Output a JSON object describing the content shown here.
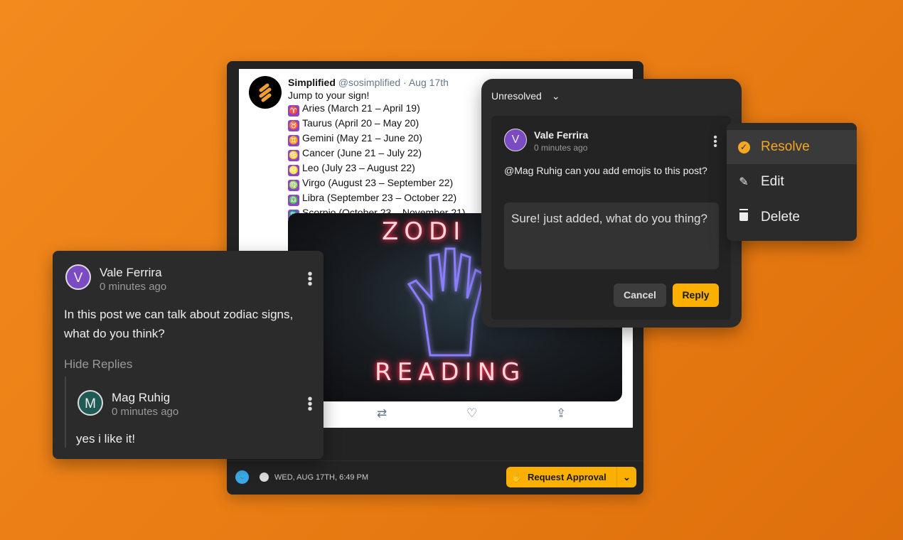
{
  "tweet": {
    "name": "Simplified",
    "handle": "@sosimplified",
    "date": "· Aug 17th",
    "intro": "Jump to your sign!",
    "signs": [
      {
        "symbol": "♈",
        "text": "Aries (March 21 – April 19)"
      },
      {
        "symbol": "♉",
        "text": "Taurus (April 20 – May 20)"
      },
      {
        "symbol": "♊",
        "text": "Gemini (May 21 – June 20)"
      },
      {
        "symbol": "♋",
        "text": "Cancer (June 21 – July 22)"
      },
      {
        "symbol": "♌",
        "text": "Leo (July 23 – August 22)"
      },
      {
        "symbol": "♍",
        "text": "Virgo (August 23 – September 22)"
      },
      {
        "symbol": "♎",
        "text": "Libra (September 23 – October 22)"
      },
      {
        "symbol": "♏",
        "text": "Scorpio (October 23 – November 21)"
      }
    ],
    "image_text": [
      "ZODI",
      "READING"
    ]
  },
  "footer": {
    "datetime": "WED, AUG 17TH, 6:49 PM",
    "request_label": "Request Approval",
    "accent": "#fbb000"
  },
  "left_comment": {
    "avatar": "V",
    "author": "Vale Ferrira",
    "time": "0 minutes ago",
    "body": "In this post we can talk about zodiac signs, what do you think?",
    "hide_replies": "Hide Replies",
    "reply": {
      "avatar": "M",
      "author": "Mag Ruhig",
      "time": "0 minutes ago",
      "body": "yes i like it!"
    }
  },
  "thread": {
    "filter": "Unresolved",
    "avatar": "V",
    "author": "Vale Ferrira",
    "time": "0 minutes ago",
    "body": "@Mag Ruhig can you add emojis to this post?",
    "reply_value": "Sure! just added, what do you thing?",
    "cancel": "Cancel",
    "reply": "Reply"
  },
  "menu": {
    "items": [
      {
        "label": "Resolve",
        "icon": "check-circle-icon"
      },
      {
        "label": "Edit",
        "icon": "pencil-icon"
      },
      {
        "label": "Delete",
        "icon": "trash-icon"
      }
    ],
    "active_color": "#f5a623"
  }
}
